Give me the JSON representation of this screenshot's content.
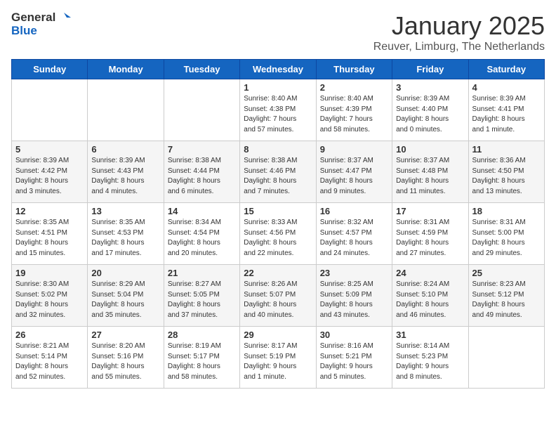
{
  "header": {
    "logo_general": "General",
    "logo_blue": "Blue",
    "month_year": "January 2025",
    "location": "Reuver, Limburg, The Netherlands"
  },
  "days_of_week": [
    "Sunday",
    "Monday",
    "Tuesday",
    "Wednesday",
    "Thursday",
    "Friday",
    "Saturday"
  ],
  "weeks": [
    [
      {
        "day": "",
        "text": ""
      },
      {
        "day": "",
        "text": ""
      },
      {
        "day": "",
        "text": ""
      },
      {
        "day": "1",
        "text": "Sunrise: 8:40 AM\nSunset: 4:38 PM\nDaylight: 7 hours\nand 57 minutes."
      },
      {
        "day": "2",
        "text": "Sunrise: 8:40 AM\nSunset: 4:39 PM\nDaylight: 7 hours\nand 58 minutes."
      },
      {
        "day": "3",
        "text": "Sunrise: 8:39 AM\nSunset: 4:40 PM\nDaylight: 8 hours\nand 0 minutes."
      },
      {
        "day": "4",
        "text": "Sunrise: 8:39 AM\nSunset: 4:41 PM\nDaylight: 8 hours\nand 1 minute."
      }
    ],
    [
      {
        "day": "5",
        "text": "Sunrise: 8:39 AM\nSunset: 4:42 PM\nDaylight: 8 hours\nand 3 minutes."
      },
      {
        "day": "6",
        "text": "Sunrise: 8:39 AM\nSunset: 4:43 PM\nDaylight: 8 hours\nand 4 minutes."
      },
      {
        "day": "7",
        "text": "Sunrise: 8:38 AM\nSunset: 4:44 PM\nDaylight: 8 hours\nand 6 minutes."
      },
      {
        "day": "8",
        "text": "Sunrise: 8:38 AM\nSunset: 4:46 PM\nDaylight: 8 hours\nand 7 minutes."
      },
      {
        "day": "9",
        "text": "Sunrise: 8:37 AM\nSunset: 4:47 PM\nDaylight: 8 hours\nand 9 minutes."
      },
      {
        "day": "10",
        "text": "Sunrise: 8:37 AM\nSunset: 4:48 PM\nDaylight: 8 hours\nand 11 minutes."
      },
      {
        "day": "11",
        "text": "Sunrise: 8:36 AM\nSunset: 4:50 PM\nDaylight: 8 hours\nand 13 minutes."
      }
    ],
    [
      {
        "day": "12",
        "text": "Sunrise: 8:35 AM\nSunset: 4:51 PM\nDaylight: 8 hours\nand 15 minutes."
      },
      {
        "day": "13",
        "text": "Sunrise: 8:35 AM\nSunset: 4:53 PM\nDaylight: 8 hours\nand 17 minutes."
      },
      {
        "day": "14",
        "text": "Sunrise: 8:34 AM\nSunset: 4:54 PM\nDaylight: 8 hours\nand 20 minutes."
      },
      {
        "day": "15",
        "text": "Sunrise: 8:33 AM\nSunset: 4:56 PM\nDaylight: 8 hours\nand 22 minutes."
      },
      {
        "day": "16",
        "text": "Sunrise: 8:32 AM\nSunset: 4:57 PM\nDaylight: 8 hours\nand 24 minutes."
      },
      {
        "day": "17",
        "text": "Sunrise: 8:31 AM\nSunset: 4:59 PM\nDaylight: 8 hours\nand 27 minutes."
      },
      {
        "day": "18",
        "text": "Sunrise: 8:31 AM\nSunset: 5:00 PM\nDaylight: 8 hours\nand 29 minutes."
      }
    ],
    [
      {
        "day": "19",
        "text": "Sunrise: 8:30 AM\nSunset: 5:02 PM\nDaylight: 8 hours\nand 32 minutes."
      },
      {
        "day": "20",
        "text": "Sunrise: 8:29 AM\nSunset: 5:04 PM\nDaylight: 8 hours\nand 35 minutes."
      },
      {
        "day": "21",
        "text": "Sunrise: 8:27 AM\nSunset: 5:05 PM\nDaylight: 8 hours\nand 37 minutes."
      },
      {
        "day": "22",
        "text": "Sunrise: 8:26 AM\nSunset: 5:07 PM\nDaylight: 8 hours\nand 40 minutes."
      },
      {
        "day": "23",
        "text": "Sunrise: 8:25 AM\nSunset: 5:09 PM\nDaylight: 8 hours\nand 43 minutes."
      },
      {
        "day": "24",
        "text": "Sunrise: 8:24 AM\nSunset: 5:10 PM\nDaylight: 8 hours\nand 46 minutes."
      },
      {
        "day": "25",
        "text": "Sunrise: 8:23 AM\nSunset: 5:12 PM\nDaylight: 8 hours\nand 49 minutes."
      }
    ],
    [
      {
        "day": "26",
        "text": "Sunrise: 8:21 AM\nSunset: 5:14 PM\nDaylight: 8 hours\nand 52 minutes."
      },
      {
        "day": "27",
        "text": "Sunrise: 8:20 AM\nSunset: 5:16 PM\nDaylight: 8 hours\nand 55 minutes."
      },
      {
        "day": "28",
        "text": "Sunrise: 8:19 AM\nSunset: 5:17 PM\nDaylight: 8 hours\nand 58 minutes."
      },
      {
        "day": "29",
        "text": "Sunrise: 8:17 AM\nSunset: 5:19 PM\nDaylight: 9 hours\nand 1 minute."
      },
      {
        "day": "30",
        "text": "Sunrise: 8:16 AM\nSunset: 5:21 PM\nDaylight: 9 hours\nand 5 minutes."
      },
      {
        "day": "31",
        "text": "Sunrise: 8:14 AM\nSunset: 5:23 PM\nDaylight: 9 hours\nand 8 minutes."
      },
      {
        "day": "",
        "text": ""
      }
    ]
  ]
}
